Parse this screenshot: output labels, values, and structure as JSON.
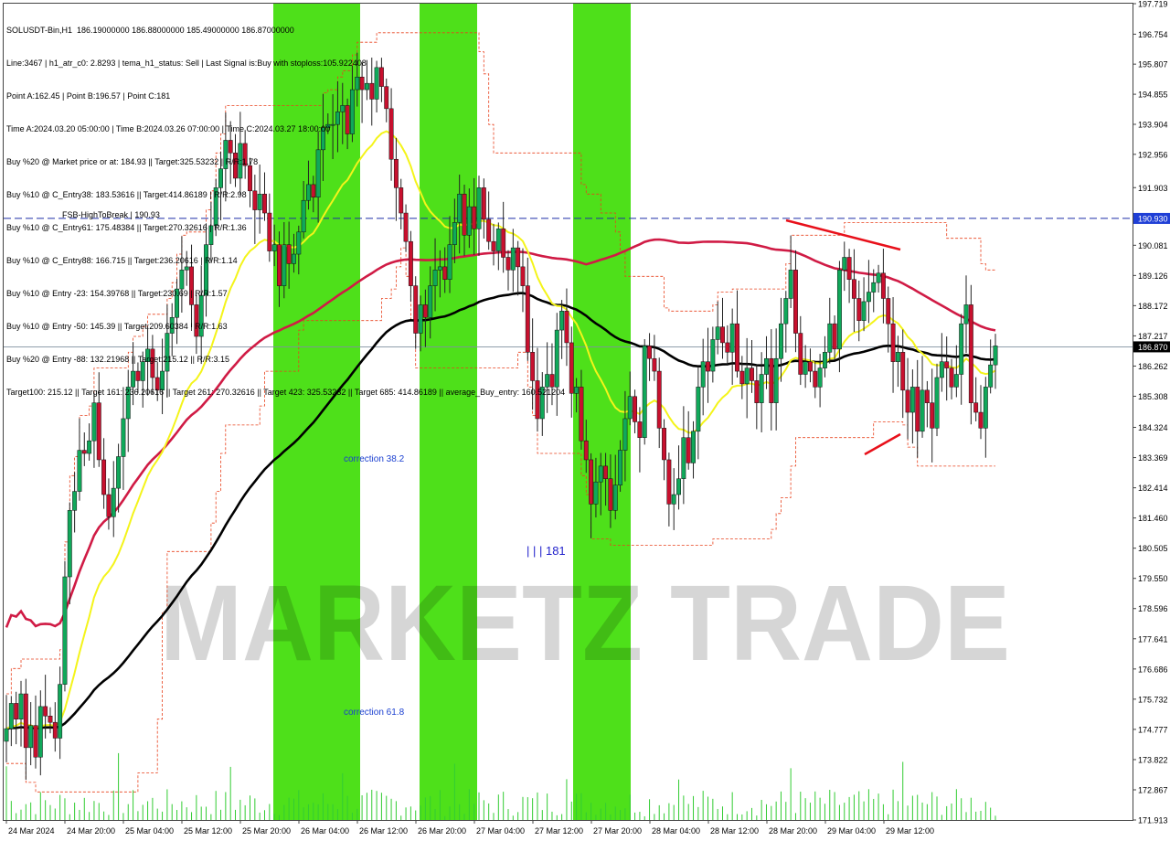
{
  "header": {
    "lines": [
      "SOLUSDT-Bin,H1  186.19000000 186.88000000 185.49000000 186.87000000",
      "Line:3467 | h1_atr_c0: 2.8293 | tema_h1_status: Sell | Last Signal is:Buy with stoploss:105.922408",
      "Point A:162.45 | Point B:196.57 | Point C:181",
      "Time A:2024.03.20 05:00:00 | Time B:2024.03.26 07:00:00 | Time C:2024.03.27 18:00:00",
      "Buy %20 @ Market price or at: 184.93 || Target:325.53232 | R/R:1.78",
      "Buy %10 @ C_Entry38: 183.53616 || Target:414.86189 | R/R:2.98",
      "Buy %10 @ C_Entry61: 175.48384 || Target:270.32616 | R/R:1.36",
      "Buy %10 @ C_Entry88: 166.715 || Target:236.20616 | R/R:1.14",
      "Buy %10 @ Entry -23: 154.39768 || Target:230.69 | R/R:1.57",
      "Buy %10 @ Entry -50: 145.39 || Target:209.60384 | R/R:1.63",
      "Buy %20 @ Entry -88: 132.21968 || Target:215.12 || R/R:3.15",
      "Target100: 215.12 || Target 161: 236.20616 || Target 261: 270.32616 || Target 423: 325.53232 || Target 685: 414.86189 || average_Buy_entry: 160.521204"
    ]
  },
  "chart_data": {
    "type": "candlestick",
    "symbol": "SOLUSDT-Bin,H1",
    "ylim": [
      171.913,
      197.719
    ],
    "y_ticks": [
      "197.719",
      "196.754",
      "195.807",
      "194.855",
      "193.904",
      "192.956",
      "191.903",
      "190.930",
      "190.081",
      "189.126",
      "188.172",
      "187.217",
      "186.870",
      "186.262",
      "185.308",
      "184.324",
      "183.369",
      "182.414",
      "181.460",
      "180.505",
      "179.550",
      "178.596",
      "177.641",
      "176.686",
      "175.732",
      "174.777",
      "173.822",
      "172.867",
      "171.913"
    ],
    "x_labels": [
      "24 Mar 2024",
      "24 Mar 20:00",
      "25 Mar 04:00",
      "25 Mar 12:00",
      "25 Mar 20:00",
      "26 Mar 04:00",
      "26 Mar 12:00",
      "26 Mar 20:00",
      "27 Mar 04:00",
      "27 Mar 12:00",
      "27 Mar 20:00",
      "28 Mar 04:00",
      "28 Mar 12:00",
      "28 Mar 20:00",
      "29 Mar 04:00",
      "29 Mar 12:00"
    ],
    "current_price": 186.87,
    "current_price_label": "186.870",
    "fsb_level": 190.93,
    "fsb_label": "FSB-HighToBreak | 190.93",
    "fsb_price_label": "190.930",
    "correction_38_label": "correction 38.2",
    "correction_61_label": "correction 61.8",
    "wave_label": "| | | 181",
    "watermark": "MARKETZ TRADE",
    "closes": [
      174.8,
      175.6,
      175.1,
      175.9,
      174.2,
      174.9,
      173.9,
      175.5,
      175.2,
      175.0,
      174.5,
      176.2,
      179.6,
      181.7,
      182.3,
      183.6,
      183.5,
      183.9,
      185.1,
      183.3,
      182.2,
      181.5,
      182.4,
      183.4,
      184.6,
      185.6,
      186.1,
      185.8,
      186.4,
      186.8,
      185.9,
      185.5,
      186.1,
      187.3,
      187.8,
      188.7,
      189.3,
      189.4,
      188.2,
      187.2,
      188.5,
      190.1,
      190.7,
      191.9,
      192.5,
      193.4,
      193.0,
      192.2,
      193.3,
      192.6,
      191.8,
      191.2,
      191.7,
      191.1,
      189.9,
      190.1,
      188.8,
      190.1,
      189.5,
      189.8,
      190.5,
      191.5,
      192.0,
      191.6,
      193.1,
      193.8,
      193.9,
      193.9,
      194.3,
      194.5,
      193.6,
      195.0,
      195.4,
      195.0,
      195.2,
      194.7,
      195.7,
      195.1,
      194.4,
      192.8,
      191.9,
      191.1,
      190.2,
      188.8,
      187.3,
      188.2,
      187.8,
      188.8,
      189.3,
      189.4,
      189.0,
      190.1,
      190.8,
      191.7,
      190.4,
      191.3,
      190.6,
      191.9,
      190.9,
      190.2,
      189.9,
      190.6,
      189.7,
      189.3,
      190.0,
      189.4,
      188.8,
      186.7,
      185.8,
      184.6,
      185.6,
      186.0,
      185.6,
      187.4,
      188.0,
      187.0,
      185.4,
      185.6,
      183.9,
      183.3,
      181.9,
      182.6,
      183.1,
      182.7,
      181.7,
      182.5,
      183.6,
      184.6,
      185.3,
      184.5,
      184.0,
      186.9,
      186.5,
      186.1,
      184.3,
      183.3,
      181.9,
      182.2,
      182.7,
      184.0,
      183.2,
      184.2,
      185.6,
      186.4,
      186.1,
      187.1,
      187.5,
      187.0,
      186.7,
      187.6,
      186.1,
      185.7,
      186.2,
      185.8,
      185.1,
      186.0,
      186.5,
      185.1,
      186.5,
      187.6,
      188.4,
      189.3,
      187.3,
      186.0,
      186.4,
      186.1,
      185.6,
      186.2,
      186.7,
      187.6,
      186.8,
      189.3,
      189.7,
      189.0,
      188.4,
      187.7,
      188.3,
      188.6,
      188.9,
      189.2,
      188.4,
      187.6,
      186.4,
      186.7,
      185.5,
      184.8,
      185.6,
      184.2,
      185.5,
      185.1,
      184.3,
      185.9,
      186.4,
      186.2,
      185.6,
      186.0,
      187.6,
      188.2,
      185.1,
      184.8,
      184.3,
      185.6,
      186.3,
      186.9
    ]
  }
}
